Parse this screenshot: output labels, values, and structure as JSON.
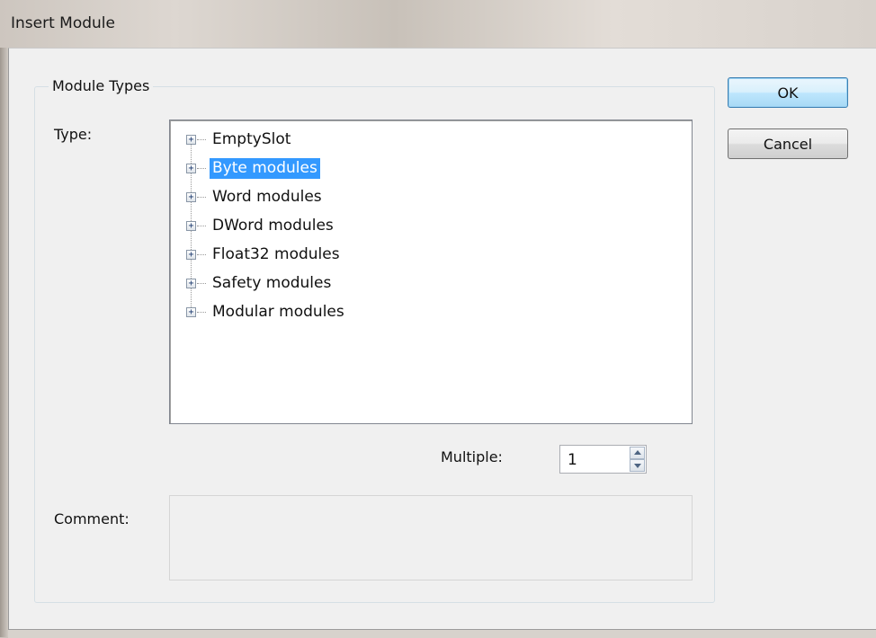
{
  "window": {
    "title": "Insert Module"
  },
  "group": {
    "label": "Module Types"
  },
  "type_label": "Type:",
  "tree": {
    "items": [
      {
        "label": "EmptySlot",
        "expander": "+",
        "selected": false
      },
      {
        "label": "Byte modules",
        "expander": "+",
        "selected": true
      },
      {
        "label": "Word modules",
        "expander": "+",
        "selected": false
      },
      {
        "label": "DWord modules",
        "expander": "+",
        "selected": false
      },
      {
        "label": "Float32 modules",
        "expander": "+",
        "selected": false
      },
      {
        "label": "Safety modules",
        "expander": "+",
        "selected": false
      },
      {
        "label": "Modular modules",
        "expander": "+",
        "selected": false
      }
    ]
  },
  "multiple": {
    "label": "Multiple:",
    "value": "1"
  },
  "comment": {
    "label": "Comment:",
    "value": ""
  },
  "buttons": {
    "ok": "OK",
    "cancel": "Cancel"
  },
  "colors": {
    "selection": "#3399ff",
    "background": "#f0f0f0"
  },
  "icons": {
    "expand": "plus-box-icon",
    "spin_up": "arrow-up-icon",
    "spin_down": "arrow-down-icon"
  }
}
